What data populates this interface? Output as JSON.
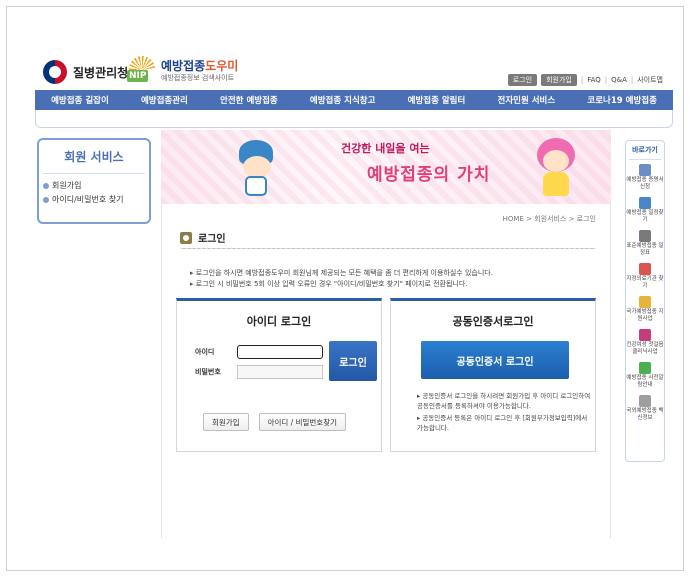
{
  "header": {
    "kdca_name": "질병관리청",
    "nip_title_a": "예방접종",
    "nip_title_b": "도우미",
    "nip_badge": "NIP",
    "nip_sub": "예방접종정보 검색사이트",
    "top_links": [
      "로그인",
      "회원가입",
      "FAQ",
      "Q&A",
      "사이트맵"
    ]
  },
  "gnb": [
    "예방접종 길잡이",
    "예방접종관리",
    "안전한 예방접종",
    "예방접종 지식창고",
    "예방접종 알림터",
    "전자민원 서비스",
    "코로나19 예방접종"
  ],
  "lnb": {
    "title": "회원 서비스",
    "items": [
      "회원가입",
      "아이디/비밀번호 찾기"
    ]
  },
  "banner": {
    "line1": "건강한 내일을 여는",
    "line2": "예방접종의 가치"
  },
  "content": {
    "breadcrumb": "HOME > 회원서비스 > 로그인",
    "title": "로그인",
    "notices": [
      "로그인을 하시면 예방접종도우미 회원님께 제공되는 모든 혜택을 좀 더 편리하게 이용하실수 있습니다.",
      "로그인 시 비밀번호 5회 이상 입력 오류인 경우 \"아이디/비밀번호 찾기\" 페이지로 전환됩니다."
    ]
  },
  "id_login": {
    "title": "아이디 로그인",
    "id_label": "아이디",
    "pw_label": "비밀번호",
    "id_value": "",
    "pw_value": "",
    "login_btn": "로그인",
    "join_btn": "회원가입",
    "find_btn": "아이디 / 비밀번호찾기"
  },
  "cert_login": {
    "title": "공동인증서로그인",
    "btn": "공동인증서 로그인",
    "notes": [
      "공동인증서 로그인을 하시려면 회원가입 후 아이디 로그인하여 공동인증서를 등록하셔야 이용가능합니다.",
      "공동인증서 등록은 아이디 로그인 후 [회원부가정보입력]에서 가능합니다."
    ]
  },
  "quick": {
    "title": "바로가기",
    "items": [
      {
        "label": "예방접종 증명서 신청",
        "color": "#6a8fc7"
      },
      {
        "label": "예방접종 일정찾기",
        "color": "#4a84c9"
      },
      {
        "label": "표준예방접종 일정표",
        "color": "#7a7a7a"
      },
      {
        "label": "지정의료기관 찾기",
        "color": "#d9534f"
      },
      {
        "label": "국가예방접종 지원사업",
        "color": "#e6b43a"
      },
      {
        "label": "건강여성 첫걸음 클리닉사업",
        "color": "#c43d7a"
      },
      {
        "label": "예방접종 사전알림안내",
        "color": "#4caf50"
      },
      {
        "label": "국외예방접종 백신정보",
        "color": "#9e9e9e"
      }
    ]
  }
}
